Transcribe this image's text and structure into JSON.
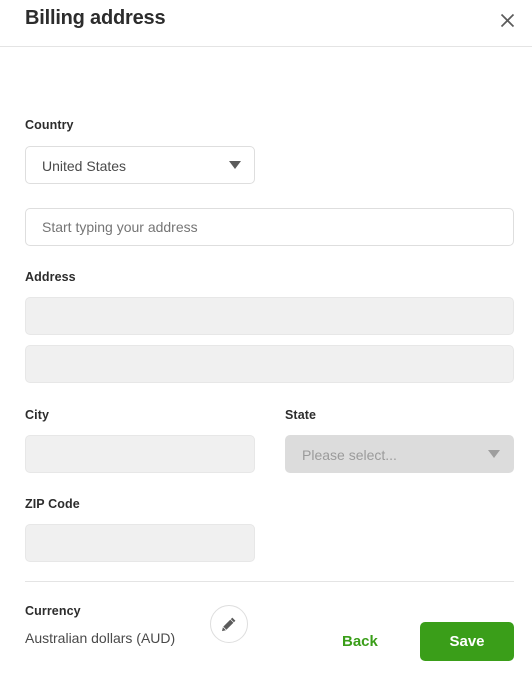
{
  "header": {
    "title": "Billing address",
    "close_icon": "close-icon"
  },
  "form": {
    "country": {
      "label": "Country",
      "value": "United States",
      "caret_icon": "chevron-down-icon"
    },
    "autocomplete": {
      "placeholder": "Start typing your address",
      "value": ""
    },
    "address": {
      "label": "Address",
      "line1_value": "",
      "line1_placeholder": "",
      "line2_value": "",
      "line2_placeholder": ""
    },
    "city": {
      "label": "City",
      "value": "",
      "placeholder": ""
    },
    "state": {
      "label": "State",
      "value": "Please select...",
      "caret_icon": "chevron-down-icon"
    },
    "zip": {
      "label": "ZIP Code",
      "value": "",
      "placeholder": ""
    }
  },
  "currency": {
    "label": "Currency",
    "value": "Australian dollars (AUD)",
    "edit_icon": "pencil-icon"
  },
  "footer": {
    "back_label": "Back",
    "save_label": "Save"
  },
  "colors": {
    "accent_green": "#3a9e19",
    "text_dark": "#2c2c2c",
    "text_muted": "#9b9b9b",
    "border": "#dedede",
    "disabled_input_bg": "#f0f0f0",
    "disabled_select_bg": "#dcdcdc",
    "divider": "#e4e4e4"
  }
}
